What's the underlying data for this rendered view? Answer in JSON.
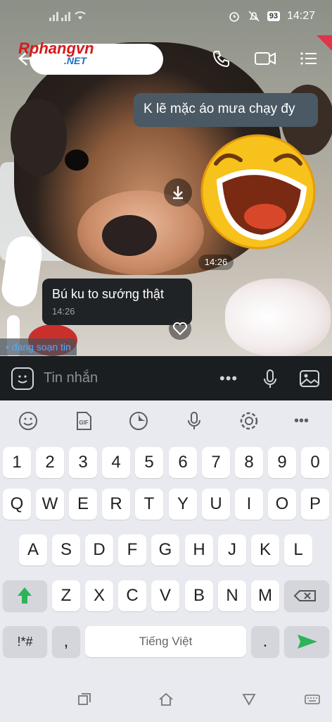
{
  "status_bar": {
    "time": "14:27",
    "battery": "93"
  },
  "header": {
    "watermark_main": "Rphangvn",
    "watermark_net": ".NET"
  },
  "chat": {
    "outgoing_message": "K lẽ mặc áo mưa chạy đy",
    "sticker_time": "14:26",
    "incoming_message": "Bú ku to sướng thật",
    "incoming_time": "14:26",
    "typing_indicator": "• đang soạn tin"
  },
  "input_bar": {
    "placeholder": "Tin nhắn",
    "more_label": "•••"
  },
  "keyboard": {
    "number_row": [
      "1",
      "2",
      "3",
      "4",
      "5",
      "6",
      "7",
      "8",
      "9",
      "0"
    ],
    "row1": [
      "Q",
      "W",
      "E",
      "R",
      "T",
      "Y",
      "U",
      "I",
      "O",
      "P"
    ],
    "row2": [
      "A",
      "S",
      "D",
      "F",
      "G",
      "H",
      "J",
      "K",
      "L"
    ],
    "row3": [
      "Z",
      "X",
      "C",
      "V",
      "B",
      "N",
      "M"
    ],
    "symbols_key": "!*#",
    "comma_key": ",",
    "space_label": "Tiếng Việt",
    "period_key": ".",
    "toolbar_more": "•••"
  },
  "colors": {
    "accent_green": "#2fb35a",
    "outgoing_bubble": "#4a5963",
    "incoming_bubble": "#1f2326",
    "typing_blue": "#4fa9ff"
  }
}
